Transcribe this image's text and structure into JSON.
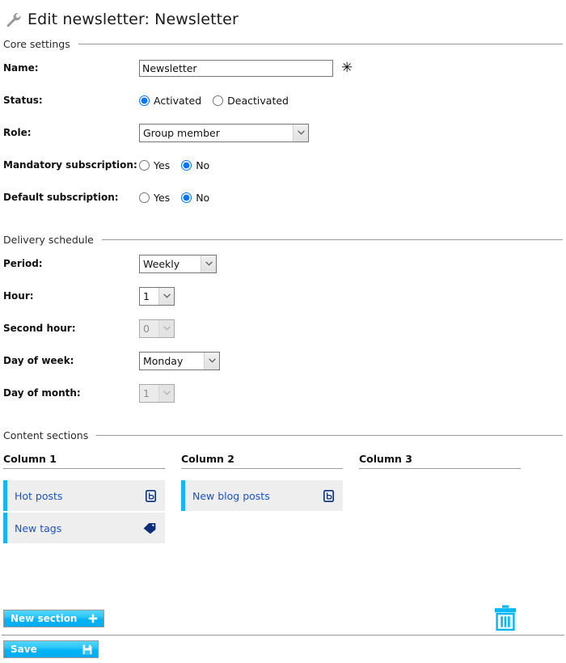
{
  "header": {
    "icon": "wrench-icon",
    "title": "Edit newsletter: Newsletter"
  },
  "core_settings": {
    "legend": "Core settings",
    "name": {
      "label": "Name:",
      "value": "Newsletter",
      "placeholder": "",
      "required_marker": "✳"
    },
    "status": {
      "label": "Status:",
      "options": [
        "Activated",
        "Deactivated"
      ],
      "selected": "Activated"
    },
    "role": {
      "label": "Role:",
      "value": "Group member",
      "icon": "chevron-down-icon"
    },
    "mandatory_subscription": {
      "label": "Mandatory subscription:",
      "options": [
        "Yes",
        "No"
      ],
      "selected": "No"
    },
    "default_subscription": {
      "label": "Default subscription:",
      "options": [
        "Yes",
        "No"
      ],
      "selected": "No"
    }
  },
  "delivery_schedule": {
    "legend": "Delivery schedule",
    "period": {
      "label": "Period:",
      "value": "Weekly",
      "disabled": false
    },
    "hour": {
      "label": "Hour:",
      "value": "1",
      "disabled": false
    },
    "second_hour": {
      "label": "Second hour:",
      "value": "0",
      "disabled": true
    },
    "day_of_week": {
      "label": "Day of week:",
      "value": "Monday",
      "disabled": false
    },
    "day_of_month": {
      "label": "Day of month:",
      "value": "1",
      "disabled": true
    }
  },
  "content_sections": {
    "legend": "Content sections",
    "columns": [
      {
        "header": "Column 1",
        "items": [
          {
            "name": "Hot posts",
            "icon": "blog-post-icon"
          },
          {
            "name": "New tags",
            "icon": "tag-icon"
          }
        ]
      },
      {
        "header": "Column 2",
        "items": [
          {
            "name": "New blog posts",
            "icon": "blog-post-icon"
          }
        ]
      },
      {
        "header": "Column 3",
        "items": []
      }
    ]
  },
  "actions": {
    "new_section": {
      "label": "New section",
      "icon": "plus-icon"
    },
    "delete": {
      "icon": "trash-icon"
    },
    "save": {
      "label": "Save",
      "icon": "floppy-disk-icon"
    }
  },
  "colors": {
    "accent_cyan": "#00b0f0",
    "link_blue": "#1a53c8",
    "icon_navy": "#0b2e7a",
    "item_bg": "#eeeeee",
    "rule_gray": "#9a9a9a"
  }
}
